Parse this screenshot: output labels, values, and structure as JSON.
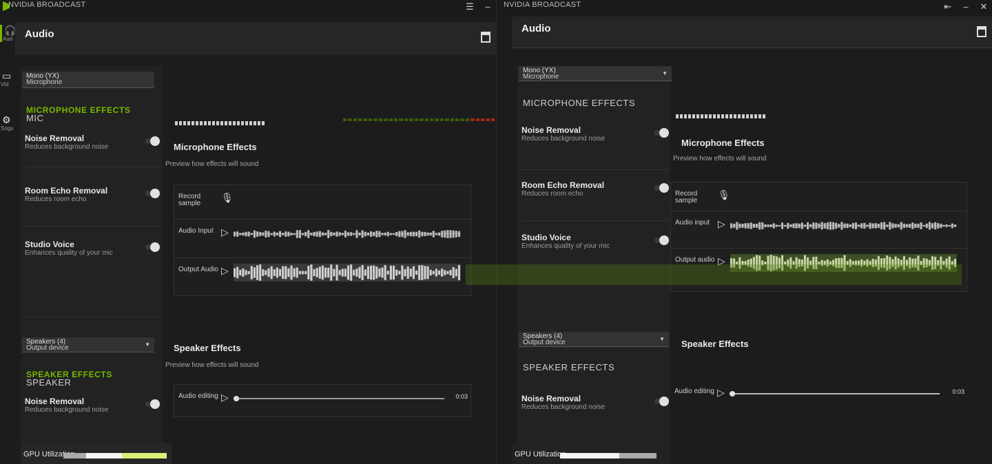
{
  "pane_a": {
    "title": "NVIDIA BROADCAST",
    "rail": [
      {
        "label": "Aud",
        "icon": "headphones-icon"
      },
      {
        "label": "Vid",
        "icon": "camera-icon"
      },
      {
        "label": "Sngs",
        "icon": "gear-icon"
      }
    ],
    "header_title": "Audio",
    "mic_select": {
      "value": "Mono (YX)",
      "sub": "Microphone"
    },
    "section_mic": {
      "prefix": "MIC",
      "label": "MICROPHONE EFFECTS"
    },
    "effects_mic": [
      {
        "name": "Noise Removal",
        "desc": "Reduces background noise"
      },
      {
        "name": "Room Echo Removal",
        "desc": "Reduces room echo"
      },
      {
        "name": "Studio Voice",
        "desc": "Enhances quality of your mic"
      }
    ],
    "speaker_select": {
      "value": "Speakers (4)",
      "sub": "Output device"
    },
    "section_spk": {
      "prefix": "SPEAKER",
      "label": "SPEAKER EFFECTS"
    },
    "effects_spk": [
      {
        "name": "Noise Removal",
        "desc": "Reduces background noise"
      }
    ],
    "right_title_1": "Microphone Effects",
    "right_sub_1": "Preview how effects will sound",
    "rows_1": [
      {
        "label": "Record sample",
        "icon": "mic-icon"
      },
      {
        "label": "Audio Input",
        "icon": "play-icon"
      },
      {
        "label": "Output Audio",
        "icon": "play-icon"
      }
    ],
    "right_title_2": "Speaker Effects",
    "right_sub_2": "Preview how effects will sound",
    "rows_2": [
      {
        "label": "Audio editing",
        "icon": "play-icon"
      }
    ],
    "bottom_label": "GPU Utilization",
    "time_label": "0:03"
  },
  "pane_b": {
    "title": "NVIDIA BROADCAST",
    "header_title": "Audio",
    "mic_select": {
      "value": "Mono (YX)",
      "sub": "Microphone"
    },
    "section_mic": {
      "label": "MICROPHONE EFFECTS"
    },
    "right_title_1": "Microphone Effects",
    "right_sub_1": "Preview how effects will sound",
    "speaker_select": {
      "value": "Speakers (4)",
      "sub": "Output device"
    },
    "section_spk": {
      "label": "SPEAKER EFFECTS"
    },
    "right_title_2": "Speaker Effects",
    "rows_1": [
      {
        "label": "Record sample"
      },
      {
        "label": "Audio input"
      },
      {
        "label": "Output audio"
      }
    ],
    "rows_2": [
      {
        "label": "Audio editing"
      }
    ],
    "effects_mic": [
      {
        "name": "Noise Removal",
        "desc": "Reduces background noise"
      },
      {
        "name": "Room Echo Removal",
        "desc": "Reduces room echo"
      },
      {
        "name": "Studio Voice",
        "desc": "Enhances quality of your mic"
      }
    ],
    "effects_spk": [
      {
        "name": "Noise Removal",
        "desc": "Reduces background noise"
      }
    ],
    "time_label": "0:03",
    "bottom_label": "GPU Utilization"
  },
  "colors": {
    "accent": "#76b900",
    "bg": "#1c1c1c",
    "panel": "#262626"
  }
}
